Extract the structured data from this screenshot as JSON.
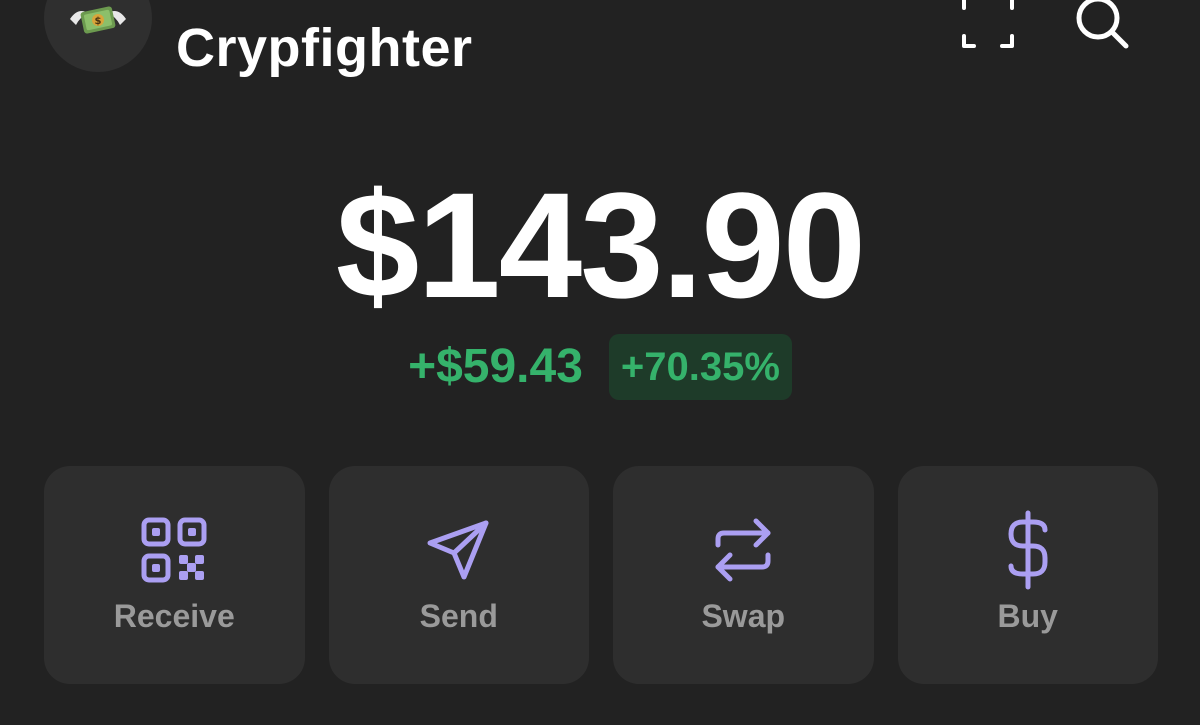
{
  "header": {
    "account_name": "Crypfighter",
    "avatar_icon": "money-with-wings-icon",
    "scan_icon": "scan-icon",
    "search_icon": "search-icon"
  },
  "balance": {
    "total": "$143.90",
    "change_amount": "+$59.43",
    "change_percent": "+70.35%"
  },
  "actions": [
    {
      "label": "Receive",
      "icon": "qr-code-icon"
    },
    {
      "label": "Send",
      "icon": "send-icon"
    },
    {
      "label": "Swap",
      "icon": "swap-icon"
    },
    {
      "label": "Buy",
      "icon": "dollar-icon"
    }
  ],
  "colors": {
    "background": "#222222",
    "card": "#2e2e2e",
    "accent": "#ab9ff2",
    "positive": "#35b26b",
    "positive_bg": "#1e3b29",
    "muted_text": "#9a9a9a"
  }
}
